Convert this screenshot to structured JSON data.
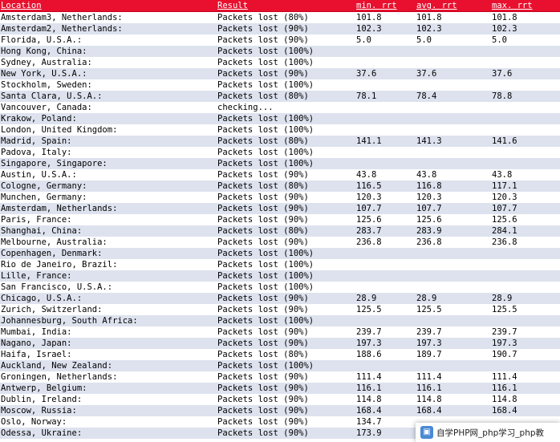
{
  "theme": {
    "header_bg": "#e8102e",
    "row_even_bg": "#ffffff",
    "row_odd_bg": "#dde2ee",
    "text_color": "#000000"
  },
  "table": {
    "headers": [
      "Location",
      "Result",
      "min. rrt",
      "avg. rrt",
      "max. rrt"
    ],
    "rows": [
      [
        "Amsterdam3, Netherlands:",
        "Packets lost (80%)",
        "101.8",
        "101.8",
        "101.8"
      ],
      [
        "Amsterdam2, Netherlands:",
        "Packets lost (90%)",
        "102.3",
        "102.3",
        "102.3"
      ],
      [
        "Florida, U.S.A.:",
        "Packets lost (90%)",
        "5.0",
        "5.0",
        "5.0"
      ],
      [
        "Hong Kong, China:",
        "Packets lost (100%)",
        "",
        "",
        ""
      ],
      [
        "Sydney, Australia:",
        "Packets lost (100%)",
        "",
        "",
        ""
      ],
      [
        "New York, U.S.A.:",
        "Packets lost (90%)",
        "37.6",
        "37.6",
        "37.6"
      ],
      [
        "Stockholm, Sweden:",
        "Packets lost (100%)",
        "",
        "",
        ""
      ],
      [
        "Santa Clara, U.S.A.:",
        "Packets lost (80%)",
        "78.1",
        "78.4",
        "78.8"
      ],
      [
        "Vancouver, Canada:",
        "checking...",
        "",
        "",
        ""
      ],
      [
        "Krakow, Poland:",
        "Packets lost (100%)",
        "",
        "",
        ""
      ],
      [
        "London, United Kingdom:",
        "Packets lost (100%)",
        "",
        "",
        ""
      ],
      [
        "Madrid, Spain:",
        "Packets lost (80%)",
        "141.1",
        "141.3",
        "141.6"
      ],
      [
        "Padova, Italy:",
        "Packets lost (100%)",
        "",
        "",
        ""
      ],
      [
        "Singapore, Singapore:",
        "Packets lost (100%)",
        "",
        "",
        ""
      ],
      [
        "Austin, U.S.A.:",
        "Packets lost (90%)",
        "43.8",
        "43.8",
        "43.8"
      ],
      [
        "Cologne, Germany:",
        "Packets lost (80%)",
        "116.5",
        "116.8",
        "117.1"
      ],
      [
        "Munchen, Germany:",
        "Packets lost (90%)",
        "120.3",
        "120.3",
        "120.3"
      ],
      [
        "Amsterdam, Netherlands:",
        "Packets lost (90%)",
        "107.7",
        "107.7",
        "107.7"
      ],
      [
        "Paris, France:",
        "Packets lost (90%)",
        "125.6",
        "125.6",
        "125.6"
      ],
      [
        "Shanghai, China:",
        "Packets lost (80%)",
        "283.7",
        "283.9",
        "284.1"
      ],
      [
        "Melbourne, Australia:",
        "Packets lost (90%)",
        "236.8",
        "236.8",
        "236.8"
      ],
      [
        "Copenhagen, Denmark:",
        "Packets lost (100%)",
        "",
        "",
        ""
      ],
      [
        "Rio de Janeiro, Brazil:",
        "Packets lost (100%)",
        "",
        "",
        ""
      ],
      [
        "Lille, France:",
        "Packets lost (100%)",
        "",
        "",
        ""
      ],
      [
        "San Francisco, U.S.A.:",
        "Packets lost (100%)",
        "",
        "",
        ""
      ],
      [
        "Chicago, U.S.A.:",
        "Packets lost (90%)",
        "28.9",
        "28.9",
        "28.9"
      ],
      [
        "Zurich, Switzerland:",
        "Packets lost (90%)",
        "125.5",
        "125.5",
        "125.5"
      ],
      [
        "Johannesburg, South Africa:",
        "Packets lost (100%)",
        "",
        "",
        ""
      ],
      [
        "Mumbai, India:",
        "Packets lost (90%)",
        "239.7",
        "239.7",
        "239.7"
      ],
      [
        "Nagano, Japan:",
        "Packets lost (90%)",
        "197.3",
        "197.3",
        "197.3"
      ],
      [
        "Haifa, Israel:",
        "Packets lost (80%)",
        "188.6",
        "189.7",
        "190.7"
      ],
      [
        "Auckland, New Zealand:",
        "Packets lost (100%)",
        "",
        "",
        ""
      ],
      [
        "Groningen, Netherlands:",
        "Packets lost (90%)",
        "111.4",
        "111.4",
        "111.4"
      ],
      [
        "Antwerp, Belgium:",
        "Packets lost (90%)",
        "116.1",
        "116.1",
        "116.1"
      ],
      [
        "Dublin, Ireland:",
        "Packets lost (90%)",
        "114.8",
        "114.8",
        "114.8"
      ],
      [
        "Moscow, Russia:",
        "Packets lost (90%)",
        "168.4",
        "168.4",
        "168.4"
      ],
      [
        "Oslo, Norway:",
        "Packets lost (90%)",
        "134.7",
        "",
        ""
      ],
      [
        "Odessa, Ukraine:",
        "Packets lost (90%)",
        "173.9",
        "",
        ""
      ]
    ]
  },
  "watermark": {
    "logo_glyph": "▣",
    "text": "自学PHP网_php学习_php教"
  }
}
